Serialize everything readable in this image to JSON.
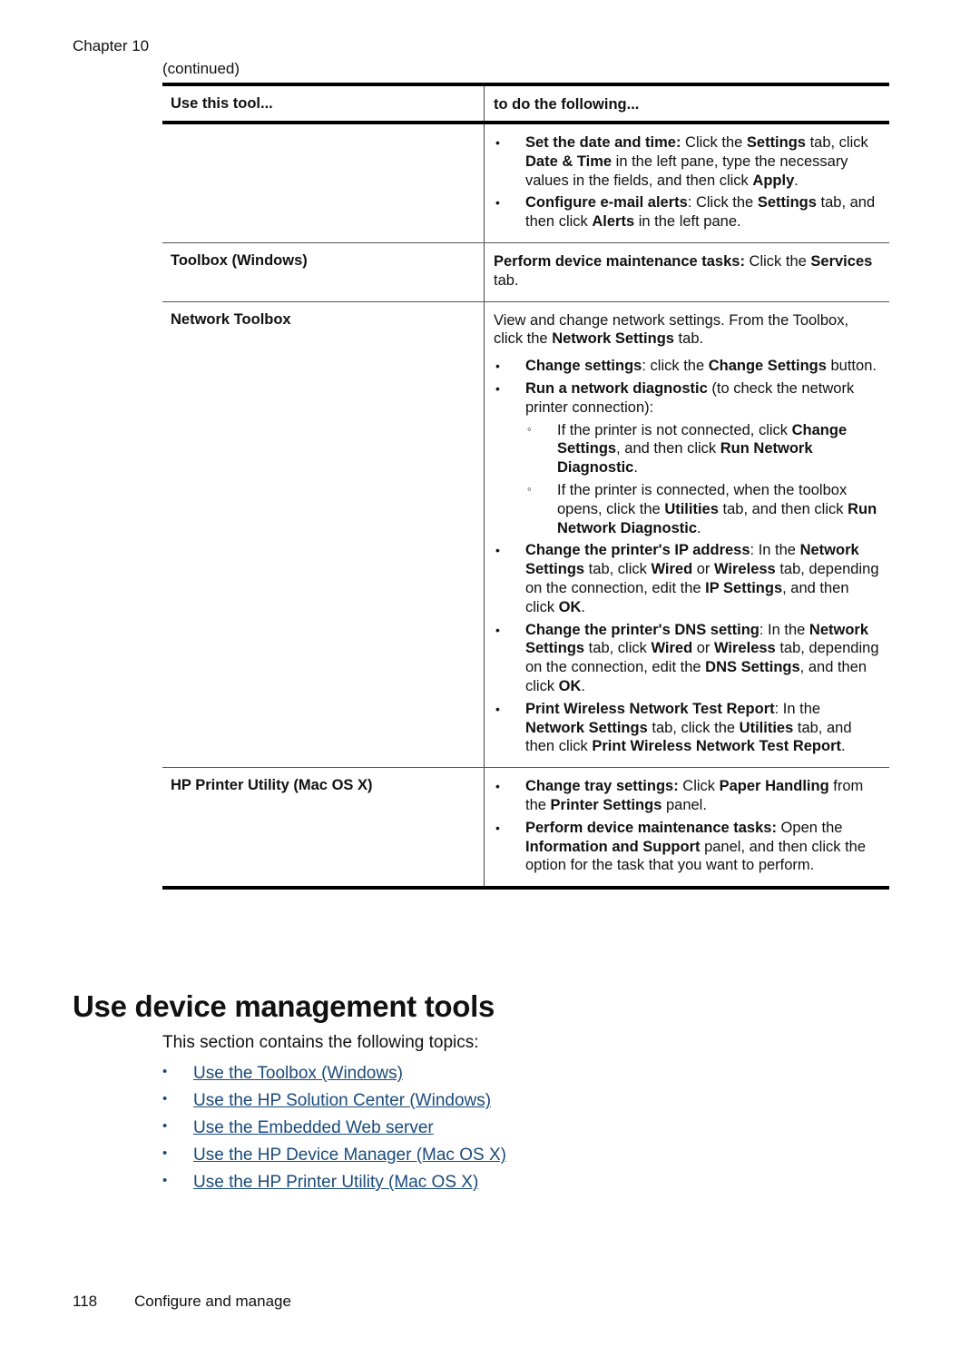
{
  "header": {
    "chapter": "Chapter 10",
    "continued": "(continued)"
  },
  "table": {
    "columns": [
      "Use this tool...",
      "to do the following..."
    ],
    "rows": [
      {
        "tool": "",
        "bullets": [
          [
            {
              "t": "Set the date and time:",
              "b": true
            },
            {
              "t": " Click the "
            },
            {
              "t": "Settings",
              "b": true
            },
            {
              "t": " tab, click "
            },
            {
              "t": "Date & Time",
              "b": true
            },
            {
              "t": " in the left pane, type the necessary values in the fields, and then click "
            },
            {
              "t": "Apply",
              "b": true
            },
            {
              "t": "."
            }
          ],
          [
            {
              "t": "Configure e-mail alerts",
              "b": true
            },
            {
              "t": ": Click the "
            },
            {
              "t": "Settings",
              "b": true
            },
            {
              "t": " tab, and then click "
            },
            {
              "t": "Alerts",
              "b": true
            },
            {
              "t": " in the left pane."
            }
          ]
        ]
      },
      {
        "tool": "Toolbox (Windows)",
        "para": [
          {
            "t": "Perform device maintenance tasks:",
            "b": true
          },
          {
            "t": " Click the "
          },
          {
            "t": "Services",
            "b": true
          },
          {
            "t": " tab."
          }
        ]
      },
      {
        "tool": "Network Toolbox",
        "para": [
          {
            "t": "View and change network settings. From the Toolbox, click the "
          },
          {
            "t": "Network Settings",
            "b": true
          },
          {
            "t": " tab."
          }
        ],
        "bullets": [
          [
            {
              "t": "Change settings",
              "b": true
            },
            {
              "t": ": click the "
            },
            {
              "t": "Change Settings",
              "b": true
            },
            {
              "t": " button."
            }
          ],
          [
            {
              "t": "Run a network diagnostic",
              "b": true
            },
            {
              "t": " (to check the network printer connection):"
            }
          ],
          [
            {
              "t": "Change the printer's IP address",
              "b": true
            },
            {
              "t": ": In the "
            },
            {
              "t": "Network Settings",
              "b": true
            },
            {
              "t": " tab, click "
            },
            {
              "t": "Wired",
              "b": true
            },
            {
              "t": " or "
            },
            {
              "t": "Wireless",
              "b": true
            },
            {
              "t": " tab, depending on the connection, edit the "
            },
            {
              "t": "IP Settings",
              "b": true
            },
            {
              "t": ", and then click "
            },
            {
              "t": "OK",
              "b": true
            },
            {
              "t": "."
            }
          ],
          [
            {
              "t": "Change the printer's DNS setting",
              "b": true
            },
            {
              "t": ": In the "
            },
            {
              "t": "Network Settings",
              "b": true
            },
            {
              "t": " tab, click "
            },
            {
              "t": "Wired",
              "b": true
            },
            {
              "t": " or "
            },
            {
              "t": "Wireless",
              "b": true
            },
            {
              "t": " tab, depending on the connection, edit the "
            },
            {
              "t": "DNS Settings",
              "b": true
            },
            {
              "t": ", and then click "
            },
            {
              "t": "OK",
              "b": true
            },
            {
              "t": "."
            }
          ],
          [
            {
              "t": "Print Wireless Network Test Report",
              "b": true
            },
            {
              "t": ": In the "
            },
            {
              "t": "Network Settings",
              "b": true
            },
            {
              "t": " tab, click the "
            },
            {
              "t": "Utilities",
              "b": true
            },
            {
              "t": " tab, and then click "
            },
            {
              "t": "Print Wireless Network Test Report",
              "b": true
            },
            {
              "t": "."
            }
          ]
        ],
        "sub_bullets_of": 1,
        "sub_bullets": [
          [
            {
              "t": "If the printer is not connected, click "
            },
            {
              "t": "Change Settings",
              "b": true
            },
            {
              "t": ", and then click "
            },
            {
              "t": "Run Network Diagnostic",
              "b": true
            },
            {
              "t": "."
            }
          ],
          [
            {
              "t": "If the printer is connected, when the toolbox opens, click the "
            },
            {
              "t": "Utilities",
              "b": true
            },
            {
              "t": " tab, and then click "
            },
            {
              "t": "Run Network Diagnostic",
              "b": true
            },
            {
              "t": "."
            }
          ]
        ]
      },
      {
        "tool": "HP Printer Utility (Mac OS X)",
        "bullets": [
          [
            {
              "t": "Change tray settings:",
              "b": true
            },
            {
              "t": " Click "
            },
            {
              "t": "Paper Handling",
              "b": true
            },
            {
              "t": " from the "
            },
            {
              "t": "Printer Settings",
              "b": true
            },
            {
              "t": " panel."
            }
          ],
          [
            {
              "t": "Perform device maintenance tasks:",
              "b": true
            },
            {
              "t": " Open the "
            },
            {
              "t": "Information and Support",
              "b": true
            },
            {
              "t": " panel, and then click the option for the task that you want to perform."
            }
          ]
        ]
      }
    ]
  },
  "section": {
    "heading": "Use device management tools",
    "intro": "This section contains the following topics:",
    "links": [
      "Use the Toolbox (Windows)",
      "Use the HP Solution Center (Windows)",
      "Use the Embedded Web server",
      "Use the HP Device Manager (Mac OS X)",
      "Use the HP Printer Utility (Mac OS X)"
    ],
    "link_color": "#1a4a7a"
  },
  "footer": {
    "page_number": "118",
    "title": "Configure and manage"
  },
  "icons": {
    "bullet": "•",
    "sub_bullet": "◦"
  }
}
